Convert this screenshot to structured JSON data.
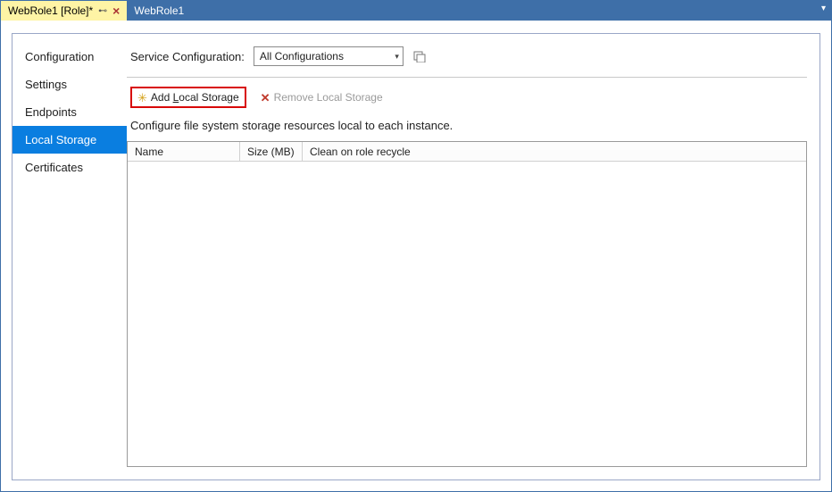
{
  "tabs": [
    {
      "label": "WebRole1 [Role]*",
      "active": true
    },
    {
      "label": "WebRole1",
      "active": false
    }
  ],
  "sidebar": {
    "items": [
      {
        "label": "Configuration",
        "selected": false
      },
      {
        "label": "Settings",
        "selected": false
      },
      {
        "label": "Endpoints",
        "selected": false
      },
      {
        "label": "Local Storage",
        "selected": true
      },
      {
        "label": "Certificates",
        "selected": false
      }
    ]
  },
  "config": {
    "label": "Service Configuration:",
    "selected": "All Configurations"
  },
  "toolbar": {
    "add_prefix": "Add ",
    "add_underline": "L",
    "add_suffix": "ocal Storage",
    "remove": "Remove Local Storage"
  },
  "description": "Configure file system storage resources local to each instance.",
  "grid": {
    "columns": [
      "Name",
      "Size (MB)",
      "Clean on role recycle"
    ]
  }
}
